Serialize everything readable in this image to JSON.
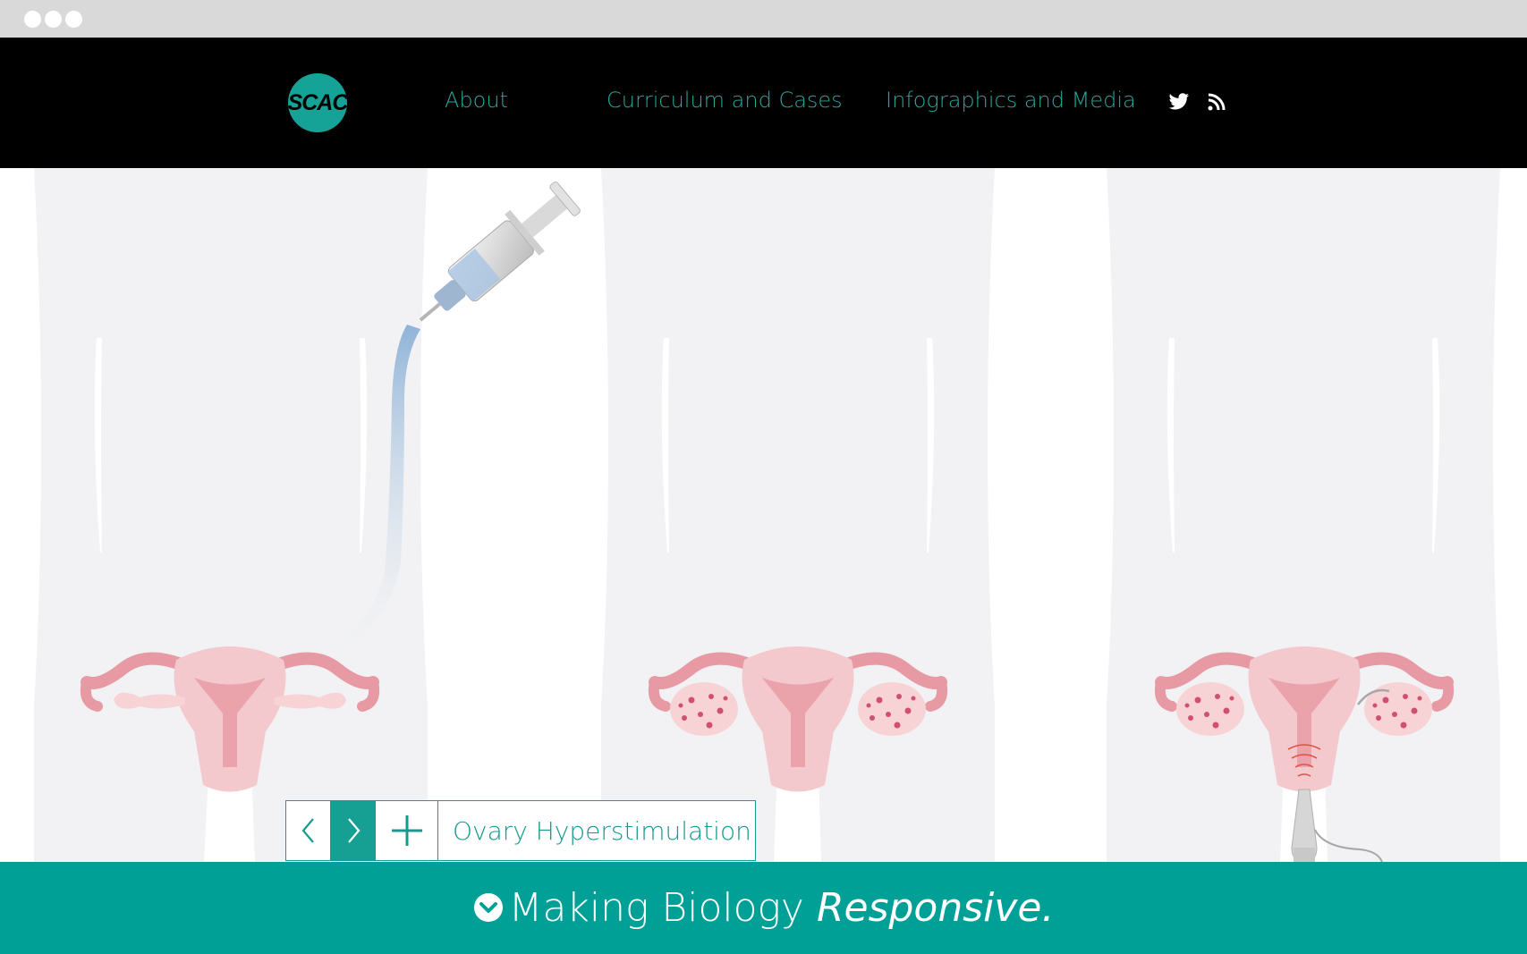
{
  "window": {
    "controls": [
      "window-dot",
      "window-dot",
      "window-dot"
    ]
  },
  "header": {
    "logo_text": "SCAC",
    "nav": [
      {
        "label": "About"
      },
      {
        "label": "Curriculum and Cases"
      },
      {
        "label": "Infographics and Media"
      }
    ],
    "social_icons": [
      "twitter-icon",
      "rss-icon"
    ]
  },
  "slideshow": {
    "caption": "Ovary Hyperstimulation",
    "controls": [
      "chevron-left-icon",
      "chevron-right-icon",
      "plus-icon"
    ]
  },
  "footer": {
    "tagline_plain": "Making Biology ",
    "tagline_emphasis": "Responsive."
  },
  "colors": {
    "accent": "#00a096",
    "nav_background": "#000000",
    "link": "#26a89d",
    "body_silhouette": "#f2f2f4",
    "uterus": "#f3c9cd"
  }
}
